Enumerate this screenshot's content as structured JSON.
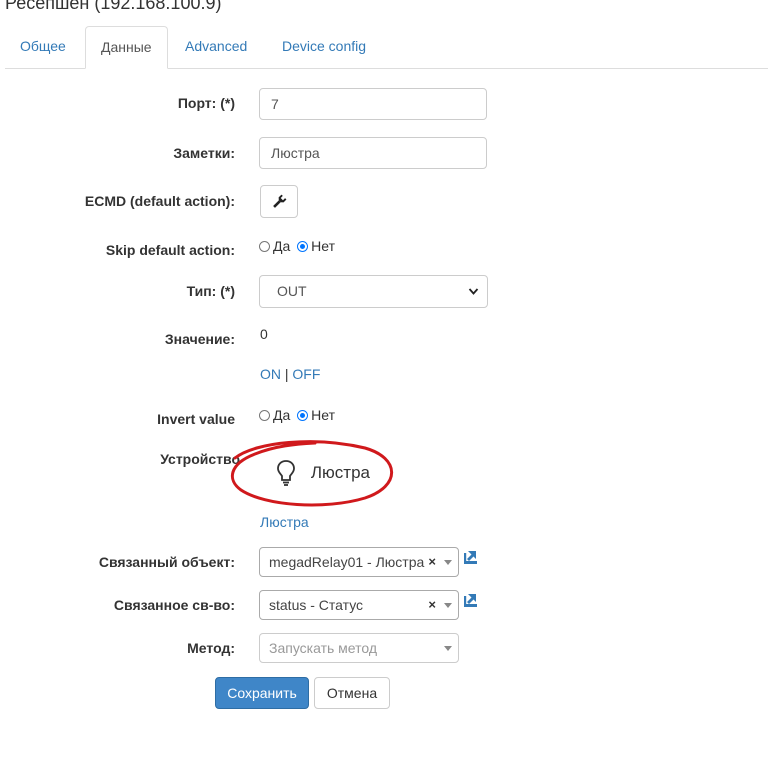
{
  "page": {
    "title": "Ресепшен (192.168.100.9)"
  },
  "tabs": [
    {
      "label": "Общее"
    },
    {
      "label": "Данные"
    },
    {
      "label": "Advanced"
    },
    {
      "label": "Device config"
    }
  ],
  "form": {
    "port": {
      "label": "Порт: (*)",
      "value": "7"
    },
    "notes": {
      "label": "Заметки:",
      "value": "Люстра"
    },
    "ecmd": {
      "label": "ECMD (default action):",
      "icon": "wrench-icon"
    },
    "skip_default": {
      "label": "Skip default action:",
      "yes": "Да",
      "no": "Нет",
      "selected": "Нет"
    },
    "type": {
      "label": "Тип: (*)",
      "value": "OUT"
    },
    "value": {
      "label": "Значение:",
      "value": "0",
      "on": "ON",
      "sep": "|",
      "off": "OFF"
    },
    "invert": {
      "label": "Invert value",
      "yes": "Да",
      "no": "Нет",
      "selected": "Нет"
    },
    "device": {
      "label": "Устройство",
      "name": "Люстра",
      "icon": "lightbulb-icon",
      "link": "Люстра",
      "annotation_color": "#d0191c"
    },
    "linked_object": {
      "label": "Связанный объект:",
      "value": "megadRelay01 - Люстра",
      "clear": "×"
    },
    "linked_property": {
      "label": "Связанное св-во:",
      "value": "status - Статус",
      "clear": "×"
    },
    "method": {
      "label": "Метод:",
      "placeholder": "Запускать метод"
    }
  },
  "buttons": {
    "save": "Сохранить",
    "cancel": "Отмена"
  },
  "colors": {
    "primary": "#3f86c8",
    "link": "#337ab7"
  }
}
